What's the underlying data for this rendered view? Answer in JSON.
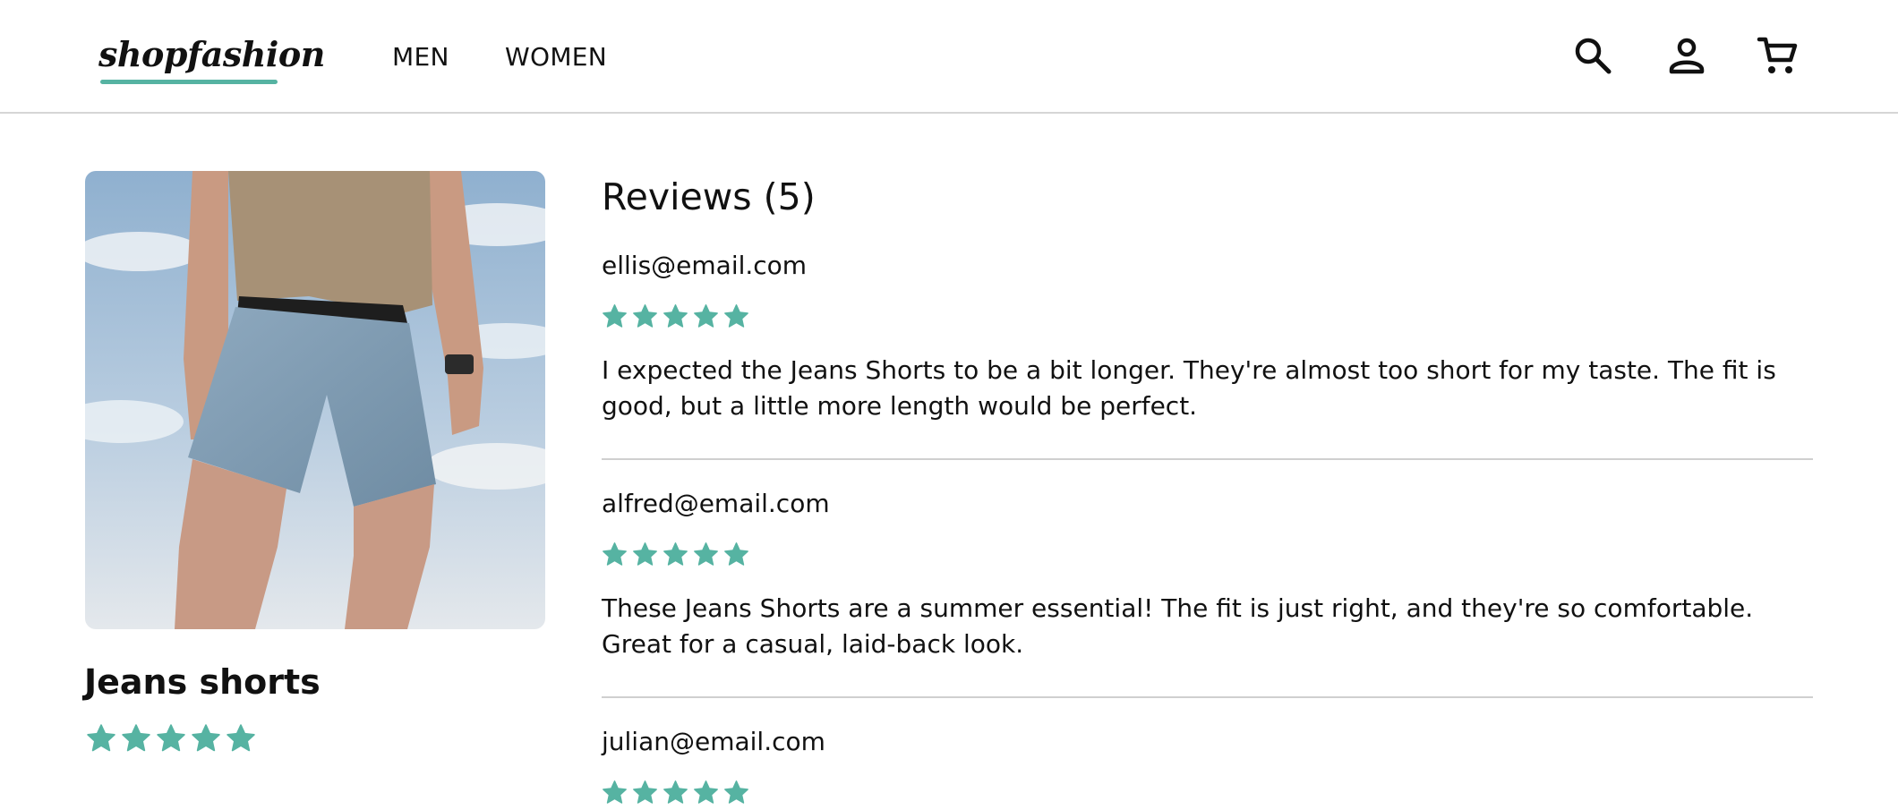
{
  "header": {
    "logo": "shopfashion",
    "nav": [
      {
        "label": "MEN"
      },
      {
        "label": "WOMEN"
      }
    ],
    "icons": [
      "search-icon",
      "user-icon",
      "cart-icon"
    ]
  },
  "product": {
    "name": "Jeans shorts",
    "rating": 5,
    "rating_max": 5
  },
  "reviews": {
    "title": "Reviews (5)",
    "items": [
      {
        "email": "ellis@email.com",
        "rating": 5,
        "text": "I expected the Jeans Shorts to be a bit longer. They're almost too short for my taste. The fit is good, but a little more length would be perfect."
      },
      {
        "email": "alfred@email.com",
        "rating": 5,
        "text": "These Jeans Shorts are a summer essential! The fit is just right, and they're so comfortable. Great for a casual, laid-back look."
      },
      {
        "email": "julian@email.com",
        "rating": 5,
        "text": ""
      }
    ]
  },
  "colors": {
    "accent": "#56b3a2",
    "divider": "#cfcfcf"
  }
}
